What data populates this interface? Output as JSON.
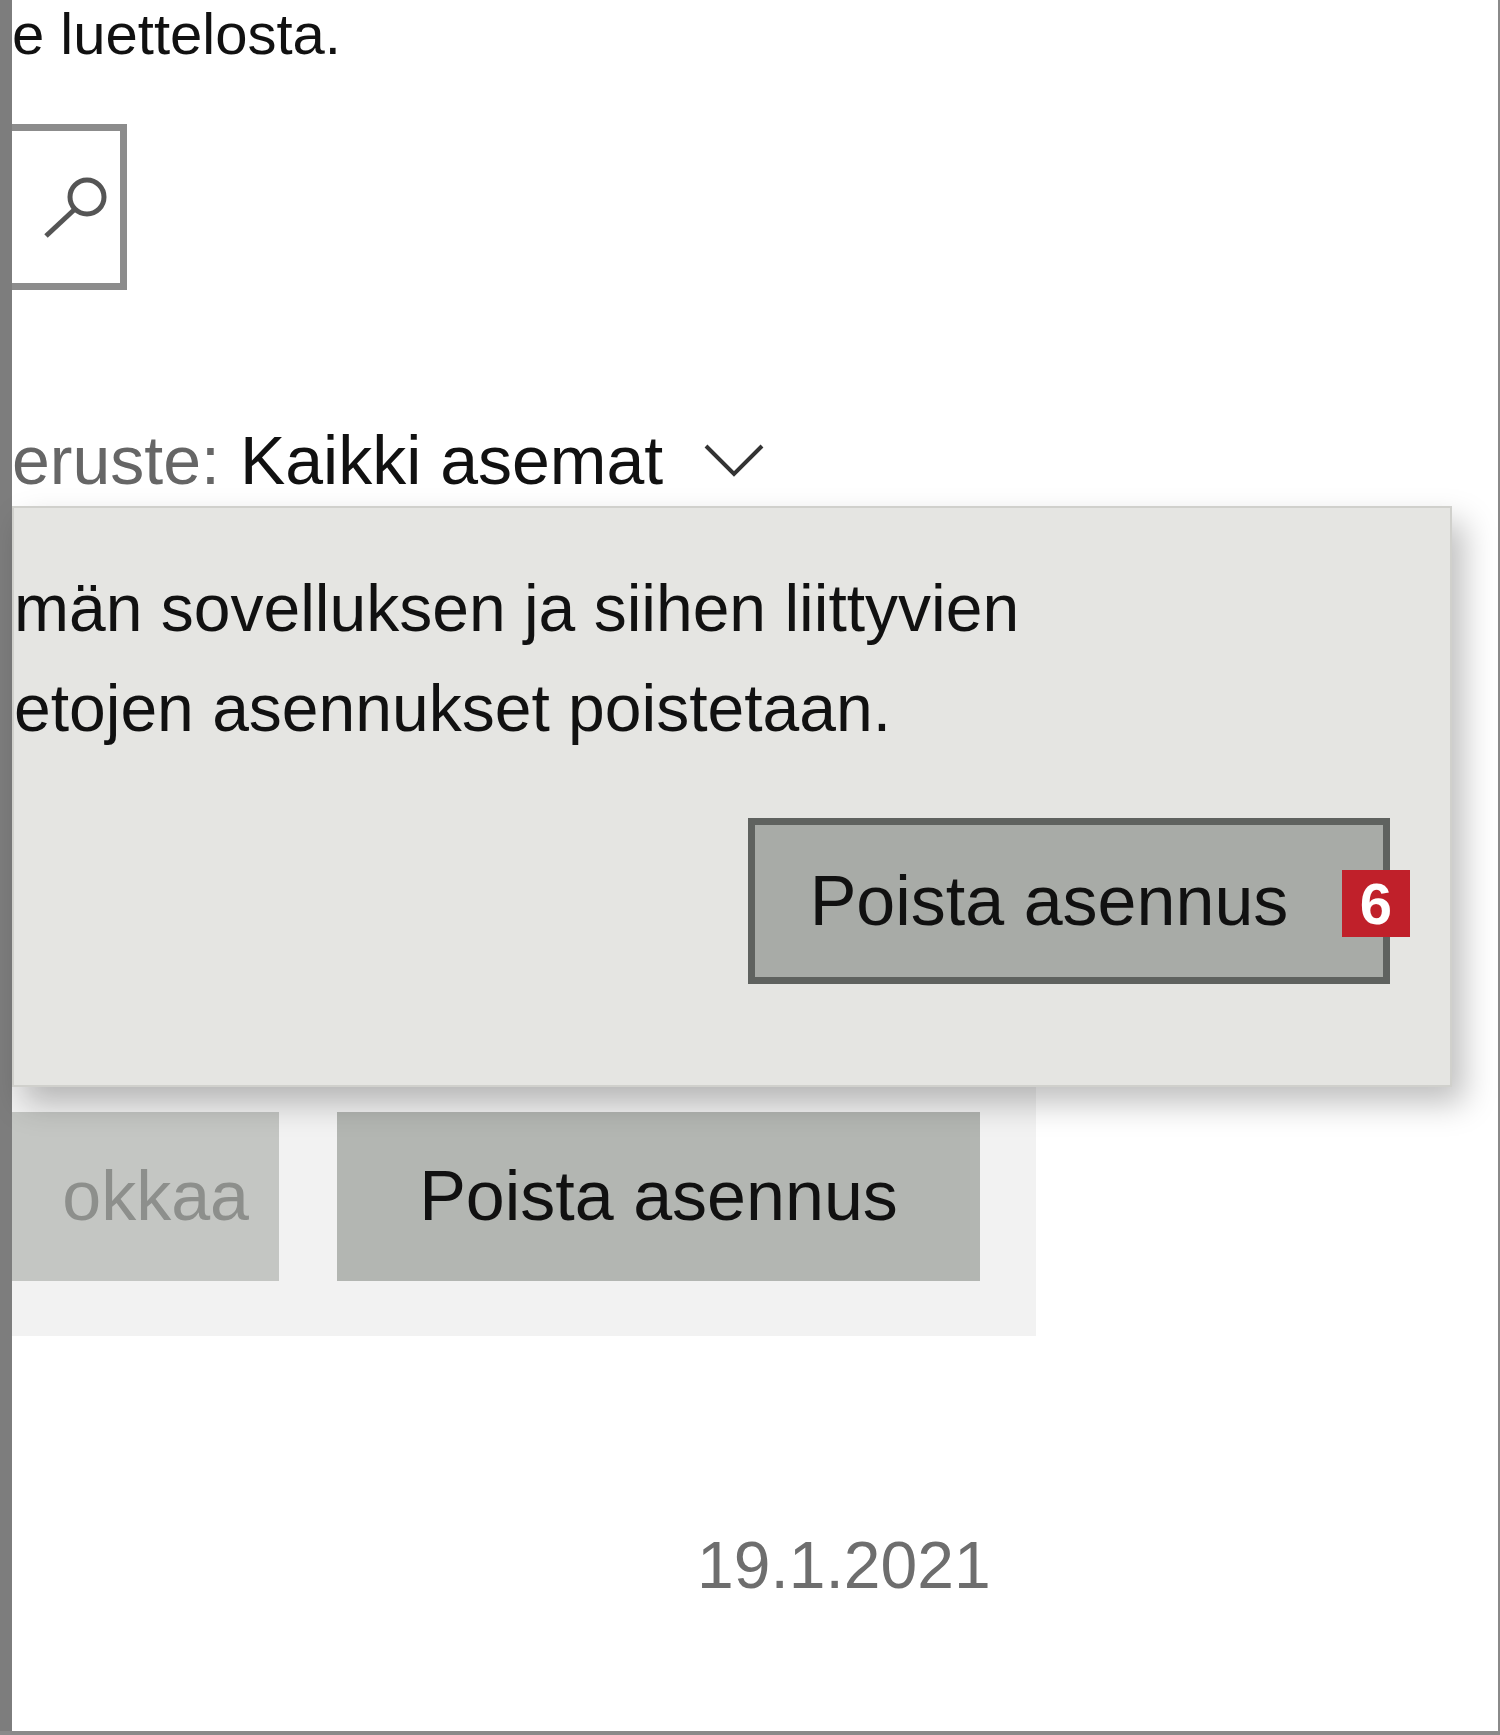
{
  "intro_text": "e luettelosta.",
  "filter": {
    "label": "eruste:",
    "value": "Kaikki asemat"
  },
  "flyout": {
    "message": [
      "män sovelluksen ja siihen liittyvien",
      "etojen asennukset poistetaan."
    ],
    "button": "Poista asennus",
    "badge": "6"
  },
  "actions": [
    {
      "label": "okkaa",
      "disabled": true
    },
    {
      "label": "Poista asennus",
      "disabled": false
    }
  ],
  "date": "19.1.2021"
}
